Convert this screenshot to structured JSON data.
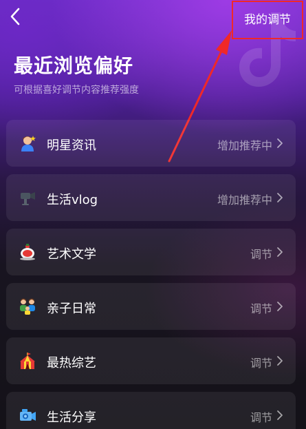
{
  "header": {
    "right_button": "我的调节"
  },
  "page": {
    "title": "最近浏览偏好",
    "subtitle": "可根据喜好调节内容推荐强度"
  },
  "items": [
    {
      "label": "明星资讯",
      "action": "增加推荐中",
      "icon": "star-person-icon"
    },
    {
      "label": "生活vlog",
      "action": "增加推荐中",
      "icon": "camera-icon"
    },
    {
      "label": "艺术文学",
      "action": "调节",
      "icon": "teacup-icon"
    },
    {
      "label": "亲子日常",
      "action": "调节",
      "icon": "family-icon"
    },
    {
      "label": "最热综艺",
      "action": "调节",
      "icon": "circus-tent-icon"
    },
    {
      "label": "生活分享",
      "action": "调节",
      "icon": "video-camera-icon"
    }
  ],
  "colors": {
    "highlight": "#f02828",
    "accent": "#6a2fc6"
  }
}
